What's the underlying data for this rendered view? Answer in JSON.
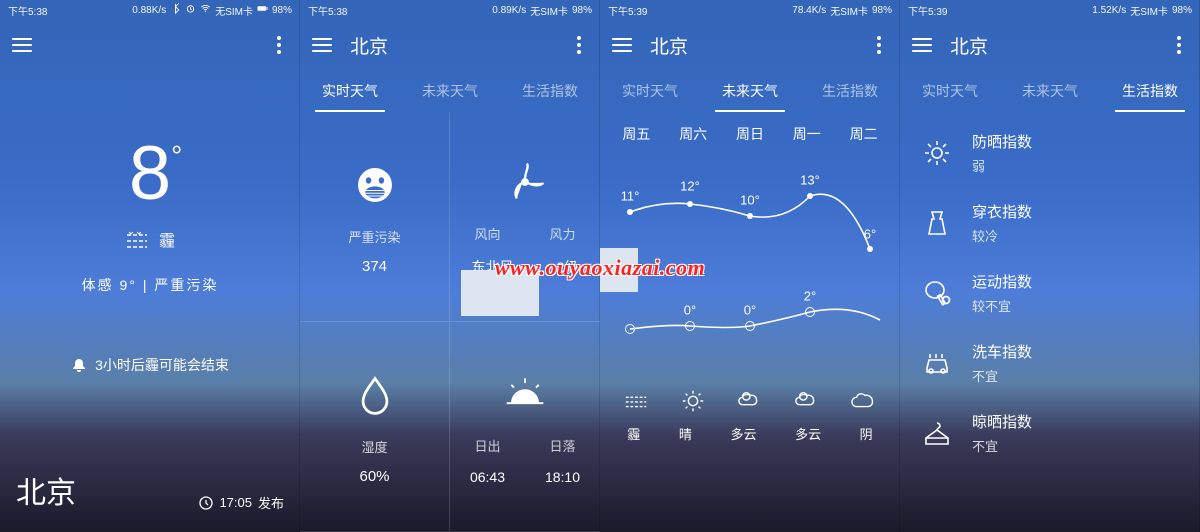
{
  "status": {
    "s1": {
      "time": "下午5:38",
      "net": "0.88K/s",
      "sim": "无SIM卡",
      "batt": "98%"
    },
    "s2": {
      "time": "下午5:38",
      "net": "0.89K/s",
      "sim": "无SIM卡",
      "batt": "98%"
    },
    "s3": {
      "time": "下午5:39",
      "net": "78.4K/s",
      "sim": "无SIM卡",
      "batt": "98%"
    },
    "s4": {
      "time": "下午5:39",
      "net": "1.52K/s",
      "sim": "无SIM卡",
      "batt": "98%"
    }
  },
  "city": "北京",
  "tabs": {
    "t1": "实时天气",
    "t2": "未来天气",
    "t3": "生活指数"
  },
  "s1": {
    "temp": "8",
    "deg": "°",
    "condition": "霾",
    "feels_label": "体感",
    "feels_value": "9°",
    "divider": "|",
    "pollution": "严重污染",
    "alert": "3小时后霾可能会结束",
    "publish_time": "17:05",
    "publish_suffix": "发布"
  },
  "s2": {
    "pollution_label": "严重污染",
    "aqi": "374",
    "wind_dir_label": "风向",
    "wind_dir": "东北风",
    "wind_force_label": "风力",
    "wind_force": "2级",
    "humidity_label": "湿度",
    "humidity": "60%",
    "sunrise_label": "日出",
    "sunrise": "06:43",
    "sunset_label": "日落",
    "sunset": "18:10"
  },
  "s3": {
    "days": [
      "周五",
      "周六",
      "周日",
      "周一",
      "周二"
    ],
    "highs": [
      "11°",
      "12°",
      "10°",
      "13°",
      "6°"
    ],
    "lows": [
      "0°",
      "0°",
      "",
      "2°",
      ""
    ],
    "names": [
      "霾",
      "晴",
      "多云",
      "多云",
      "阴"
    ]
  },
  "s4": {
    "items": [
      {
        "name": "防晒指数",
        "val": "弱"
      },
      {
        "name": "穿衣指数",
        "val": "较冷"
      },
      {
        "name": "运动指数",
        "val": "较不宜"
      },
      {
        "name": "洗车指数",
        "val": "不宜"
      },
      {
        "name": "晾晒指数",
        "val": "不宜"
      }
    ]
  },
  "watermark": "www.ouyaoxiazai.com"
}
